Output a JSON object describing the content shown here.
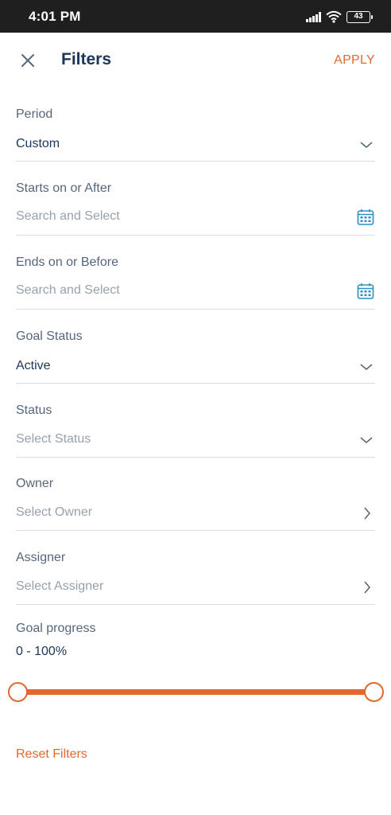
{
  "status_bar": {
    "time": "4:01 PM",
    "battery": "43",
    "icons": [
      "signal-icon",
      "wifi-icon",
      "battery-icon"
    ]
  },
  "header": {
    "title": "Filters",
    "apply_label": "APPLY",
    "close_icon": "close-icon"
  },
  "fields": {
    "period": {
      "label": "Period",
      "value": "Custom",
      "icon": "chevron-down-icon"
    },
    "starts": {
      "label": "Starts on or After",
      "placeholder": "Search and Select",
      "icon": "calendar-icon"
    },
    "ends": {
      "label": "Ends on or Before",
      "placeholder": "Search and Select",
      "icon": "calendar-icon"
    },
    "goal_status": {
      "label": "Goal Status",
      "value": "Active",
      "icon": "chevron-down-icon"
    },
    "status": {
      "label": "Status",
      "placeholder": "Select Status",
      "icon": "chevron-down-icon"
    },
    "owner": {
      "label": "Owner",
      "placeholder": "Select Owner",
      "icon": "chevron-right-icon"
    },
    "assigner": {
      "label": "Assigner",
      "placeholder": "Select Assigner",
      "icon": "chevron-right-icon"
    }
  },
  "goal_progress": {
    "label": "Goal progress",
    "value": "0 - 100%",
    "min": 0,
    "max": 100
  },
  "reset_label": "Reset Filters",
  "colors": {
    "accent": "#e3672e",
    "title": "#1d3557",
    "label": "#56677b",
    "placeholder": "#97a1ad",
    "calendar": "#2f8ec2",
    "status_bar": "#1f1f1f"
  }
}
